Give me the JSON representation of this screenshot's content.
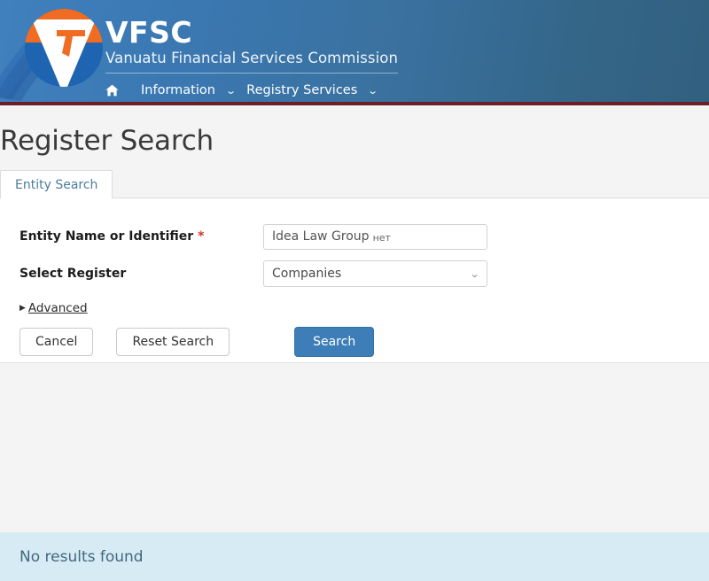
{
  "header": {
    "logo_icon": "vfsc-logo-icon",
    "brand_abbr": "VFSC",
    "brand_full": "Vanuatu Financial Services Commission",
    "nav": {
      "home_icon": "home-icon",
      "items": [
        {
          "label": "Information",
          "caret": "⌄"
        },
        {
          "label": "Registry Services",
          "caret": "⌄"
        }
      ]
    },
    "accent_blue": "#3d7eb8",
    "accent_maroon": "#6b1f26",
    "logo_orange": "#ef6c22"
  },
  "page": {
    "title": "Register Search"
  },
  "tabs": [
    {
      "label": "Entity Search",
      "active": true
    }
  ],
  "form": {
    "fields": [
      {
        "label": "Entity Name or Identifier",
        "required_marker": "*",
        "value_main": "Idea Law Group",
        "value_sub": "нет",
        "placeholder": "Entity Name or Identifier"
      },
      {
        "label": "Select Register",
        "selected": "Companies",
        "caret_icon": "chevron-down-icon",
        "options": [
          "Companies"
        ]
      }
    ],
    "advanced": {
      "arrow_icon": "triangle-right-icon",
      "label": "Advanced"
    },
    "buttons": {
      "cancel": "Cancel",
      "reset": "Reset Search",
      "search": "Search"
    }
  },
  "results": {
    "message": "No results found",
    "background": "#d7ebf5",
    "text_color": "#41697c"
  }
}
